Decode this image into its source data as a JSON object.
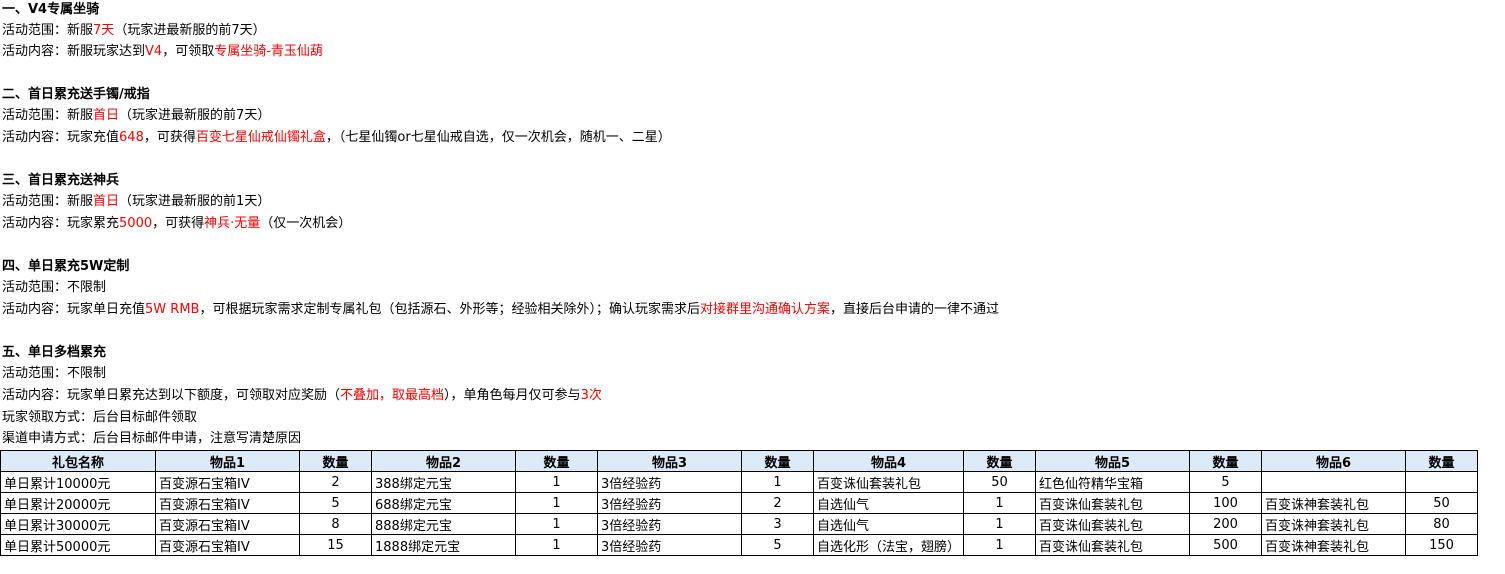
{
  "sections": {
    "s1": {
      "title": "一、V4专属坐骑",
      "scope": {
        "label": "活动范围：",
        "a": "新服",
        "b": "7天",
        "c": "（玩家进最新服的前7天）"
      },
      "content": {
        "label": "活动内容：",
        "a": "新服玩家达到",
        "b": "V4",
        "c": "，可领取",
        "d": "专属坐骑-青玉仙葫"
      }
    },
    "s2": {
      "title": "二、首日累充送手镯/戒指",
      "scope": {
        "label": "活动范围：",
        "a": "新服",
        "b": "首日",
        "c": "（玩家进最新服的前7天）"
      },
      "content": {
        "label": "活动内容：",
        "a": "玩家充值",
        "b": "648",
        "c": "，可获得",
        "d": "百变七星仙戒仙镯礼盒",
        "e": "，（七星仙镯or七星仙戒自选，仅一次机会，随机一、二星）"
      }
    },
    "s3": {
      "title": "三、首日累充送神兵",
      "scope": {
        "label": "活动范围：",
        "a": "新服",
        "b": "首日",
        "c": "（玩家进最新服的前1天）"
      },
      "content": {
        "label": "活动内容：",
        "a": "玩家累充",
        "b": "5000",
        "c": "，可获得",
        "d": "神兵·无量",
        "e": "（仅一次机会）"
      }
    },
    "s4": {
      "title": "四、单日累充5W定制",
      "scope": {
        "label": "活动范围：",
        "a": "不限制"
      },
      "content": {
        "label": "活动内容：",
        "a": "玩家单日充值",
        "b": "5W RMB",
        "c": "，可根据玩家需求定制专属礼包（包括源石、外形等；经验相关除外）；确认玩家需求后",
        "d": "对接群里沟通确认方案",
        "e": "，直接后台申请的一律不通过"
      }
    },
    "s5": {
      "title": "五、单日多档累充",
      "scope": {
        "label": "活动范围：",
        "a": "不限制"
      },
      "content": {
        "label": "活动内容：",
        "a": "玩家单日累充达到以下额度，可领取对应奖励（",
        "b": "不叠加，取最高档",
        "c": "），单角色每月仅可参与",
        "d": "3次"
      },
      "claim": "玩家领取方式：后台目标邮件领取",
      "channel": "渠道申请方式：后台目标邮件申请，注意写清楚原因"
    }
  },
  "table": {
    "headers": [
      "礼包名称",
      "物品1",
      "数量",
      "物品2",
      "数量",
      "物品3",
      "数量",
      "物品4",
      "数量",
      "物品5",
      "数量",
      "物品6",
      "数量"
    ],
    "rows": [
      [
        "单日累计10000元",
        "百变源石宝箱IV",
        "2",
        "388绑定元宝",
        "1",
        "3倍经验药",
        "1",
        "百变诛仙套装礼包",
        "50",
        "红色仙符精华宝箱",
        "5",
        "",
        ""
      ],
      [
        "单日累计20000元",
        "百变源石宝箱IV",
        "5",
        "688绑定元宝",
        "1",
        "3倍经验药",
        "2",
        "自选仙气",
        "1",
        "百变诛仙套装礼包",
        "100",
        "百变诛神套装礼包",
        "50"
      ],
      [
        "单日累计30000元",
        "百变源石宝箱IV",
        "8",
        "888绑定元宝",
        "1",
        "3倍经验药",
        "3",
        "自选仙气",
        "1",
        "百变诛仙套装礼包",
        "200",
        "百变诛神套装礼包",
        "80"
      ],
      [
        "单日累计50000元",
        "百变源石宝箱IV",
        "15",
        "1888绑定元宝",
        "1",
        "3倍经验药",
        "5",
        "自选化形（法宝，翅膀）",
        "1",
        "百变诛仙套装礼包",
        "500",
        "百变诛神套装礼包",
        "150"
      ]
    ]
  }
}
